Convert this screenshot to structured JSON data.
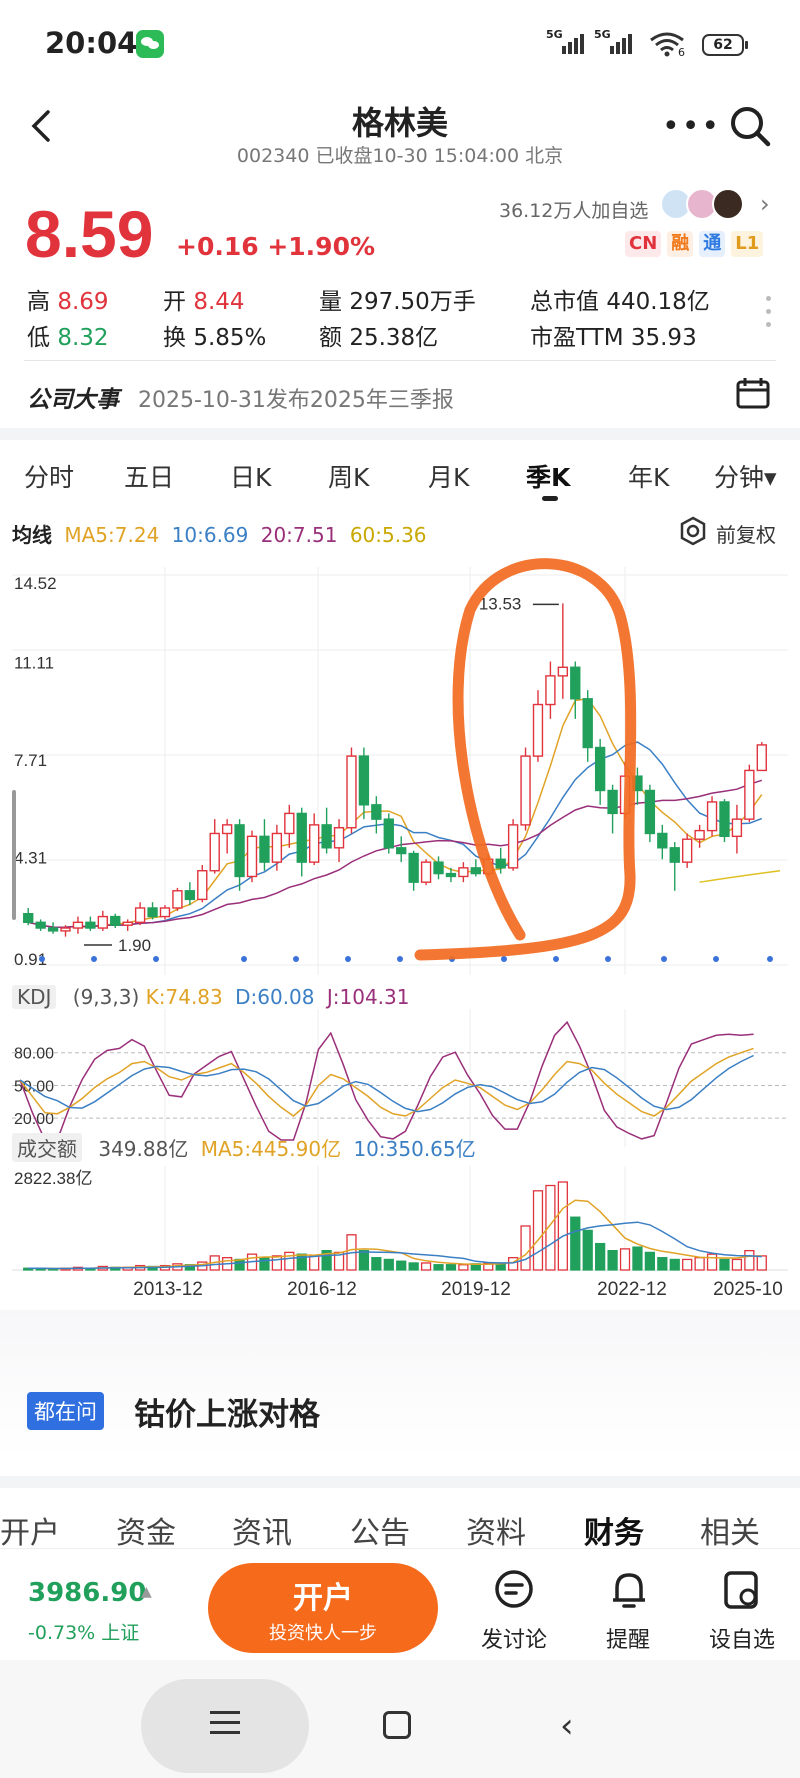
{
  "status_bar": {
    "time": "20:04",
    "net1": "5G",
    "net2": "5G",
    "wifi_num": "6",
    "battery": "62"
  },
  "header": {
    "title": "格林美",
    "subtitle": "002340 已收盘10-30 15:04:00 北京"
  },
  "quote": {
    "price": "8.59",
    "change": "+0.16 +1.90%",
    "followers": "36.12万人加自选",
    "tags": [
      {
        "text": "CN",
        "color": "#e0333c",
        "bg": "#fde9e9"
      },
      {
        "text": "融",
        "color": "#f07a1c",
        "bg": "#fdefe3"
      },
      {
        "text": "通",
        "color": "#2f7ae0",
        "bg": "#e6f0fd"
      },
      {
        "text": "L1",
        "color": "#e09a1c",
        "bg": "#fdf3de"
      }
    ]
  },
  "stats": {
    "high_label": "高",
    "high": "8.69",
    "open_label": "开",
    "open": "8.44",
    "vol_label": "量",
    "vol": "297.50万手",
    "mcap_label": "总市值",
    "mcap": "440.18亿",
    "low_label": "低",
    "low": "8.32",
    "turn_label": "换",
    "turn": "5.85%",
    "amt_label": "额",
    "amt": "25.38亿",
    "pe_label": "市盈TTM",
    "pe": "35.93"
  },
  "event": {
    "label": "公司大事",
    "text": "2025-10-31发布2025年三季报"
  },
  "tabs": [
    "分时",
    "五日",
    "日K",
    "周K",
    "月K",
    "季K",
    "年K",
    "分钟▾"
  ],
  "ma_line": {
    "label": "均线",
    "ma5": "MA5:7.24",
    "ma10": "10:6.69",
    "ma20": "20:7.51",
    "ma60": "60:5.36",
    "fq": "前复权"
  },
  "kdj": {
    "label": "KDJ",
    "params": "(9,3,3)",
    "k": "K:74.83",
    "d": "D:60.08",
    "j": "J:104.31"
  },
  "volume": {
    "label": "成交额",
    "val": "349.88亿",
    "ma5": "MA5:445.90亿",
    "ma10": "10:350.65亿"
  },
  "colors": {
    "up": "#e0333c",
    "down": "#21a05c",
    "ma5": "#e0a326",
    "ma10": "#3b7fc4",
    "ma20": "#9a2f7a",
    "ma60": "#e0c020",
    "annot": "#f26b21"
  },
  "chart_data": {
    "type": "candlestick",
    "ylim": [
      0.91,
      14.52
    ],
    "y_ticks": [
      "14.52",
      "11.11",
      "7.71",
      "4.31",
      "0.91"
    ],
    "x_ticks": [
      "2013-12",
      "2016-12",
      "2019-12",
      "2022-12",
      "2025-10"
    ],
    "max_label": "13.53",
    "min_label": "1.90",
    "ohlc": [
      [
        2.7,
        2.9,
        2.3,
        2.4
      ],
      [
        2.4,
        2.5,
        2.1,
        2.2
      ],
      [
        2.2,
        2.4,
        2.0,
        2.1
      ],
      [
        2.1,
        2.3,
        1.9,
        2.2
      ],
      [
        2.2,
        2.6,
        2.0,
        2.4
      ],
      [
        2.4,
        2.6,
        2.1,
        2.2
      ],
      [
        2.2,
        2.8,
        2.1,
        2.6
      ],
      [
        2.6,
        2.7,
        2.2,
        2.3
      ],
      [
        2.3,
        2.5,
        2.1,
        2.4
      ],
      [
        2.4,
        3.1,
        2.3,
        2.9
      ],
      [
        2.9,
        3.1,
        2.5,
        2.6
      ],
      [
        2.6,
        3.0,
        2.5,
        2.9
      ],
      [
        2.9,
        3.6,
        2.8,
        3.5
      ],
      [
        3.5,
        3.8,
        3.0,
        3.2
      ],
      [
        3.2,
        4.4,
        3.1,
        4.2
      ],
      [
        4.2,
        6.0,
        4.1,
        5.5
      ],
      [
        5.5,
        6.0,
        4.8,
        5.8
      ],
      [
        5.8,
        6.0,
        3.5,
        4.0
      ],
      [
        4.0,
        5.6,
        3.8,
        5.4
      ],
      [
        5.4,
        6.0,
        4.2,
        4.5
      ],
      [
        4.5,
        5.8,
        4.2,
        5.5
      ],
      [
        5.5,
        6.5,
        5.0,
        6.2
      ],
      [
        6.2,
        6.4,
        4.0,
        4.5
      ],
      [
        4.5,
        6.2,
        4.4,
        5.8
      ],
      [
        5.8,
        6.4,
        4.8,
        5.0
      ],
      [
        5.0,
        6.0,
        4.5,
        5.7
      ],
      [
        5.7,
        8.5,
        5.5,
        8.2
      ],
      [
        8.2,
        8.5,
        6.0,
        6.5
      ],
      [
        6.5,
        6.8,
        5.5,
        6.0
      ],
      [
        6.0,
        6.2,
        4.8,
        5.0
      ],
      [
        5.0,
        5.4,
        4.5,
        4.8
      ],
      [
        4.8,
        4.9,
        3.5,
        3.8
      ],
      [
        3.8,
        4.6,
        3.7,
        4.5
      ],
      [
        4.5,
        4.7,
        3.9,
        4.1
      ],
      [
        4.1,
        4.3,
        3.8,
        4.0
      ],
      [
        4.0,
        4.5,
        3.8,
        4.3
      ],
      [
        4.3,
        4.6,
        4.0,
        4.1
      ],
      [
        4.1,
        4.8,
        4.0,
        4.6
      ],
      [
        4.6,
        5.0,
        4.1,
        4.3
      ],
      [
        4.3,
        6.0,
        4.2,
        5.8
      ],
      [
        5.8,
        8.5,
        5.6,
        8.2
      ],
      [
        8.2,
        10.5,
        8.0,
        10.0
      ],
      [
        10.0,
        11.5,
        9.5,
        11.0
      ],
      [
        11.0,
        13.53,
        10.2,
        11.3
      ],
      [
        11.3,
        11.5,
        9.5,
        10.2
      ],
      [
        10.2,
        10.5,
        8.0,
        8.5
      ],
      [
        8.5,
        8.8,
        6.5,
        7.0
      ],
      [
        7.0,
        7.2,
        5.5,
        6.2
      ],
      [
        6.2,
        8.0,
        6.0,
        7.5
      ],
      [
        7.5,
        7.8,
        6.5,
        7.0
      ],
      [
        7.0,
        7.2,
        5.2,
        5.5
      ],
      [
        5.5,
        5.8,
        4.6,
        5.0
      ],
      [
        5.0,
        5.2,
        3.5,
        4.5
      ],
      [
        4.5,
        5.5,
        4.3,
        5.3
      ],
      [
        5.3,
        5.8,
        5.0,
        5.6
      ],
      [
        5.6,
        6.8,
        5.4,
        6.6
      ],
      [
        6.6,
        6.7,
        5.2,
        5.4
      ],
      [
        5.4,
        6.5,
        4.8,
        6.0
      ],
      [
        6.0,
        7.9,
        5.9,
        7.7
      ],
      [
        7.7,
        8.69,
        8.32,
        8.59
      ]
    ]
  }
}
